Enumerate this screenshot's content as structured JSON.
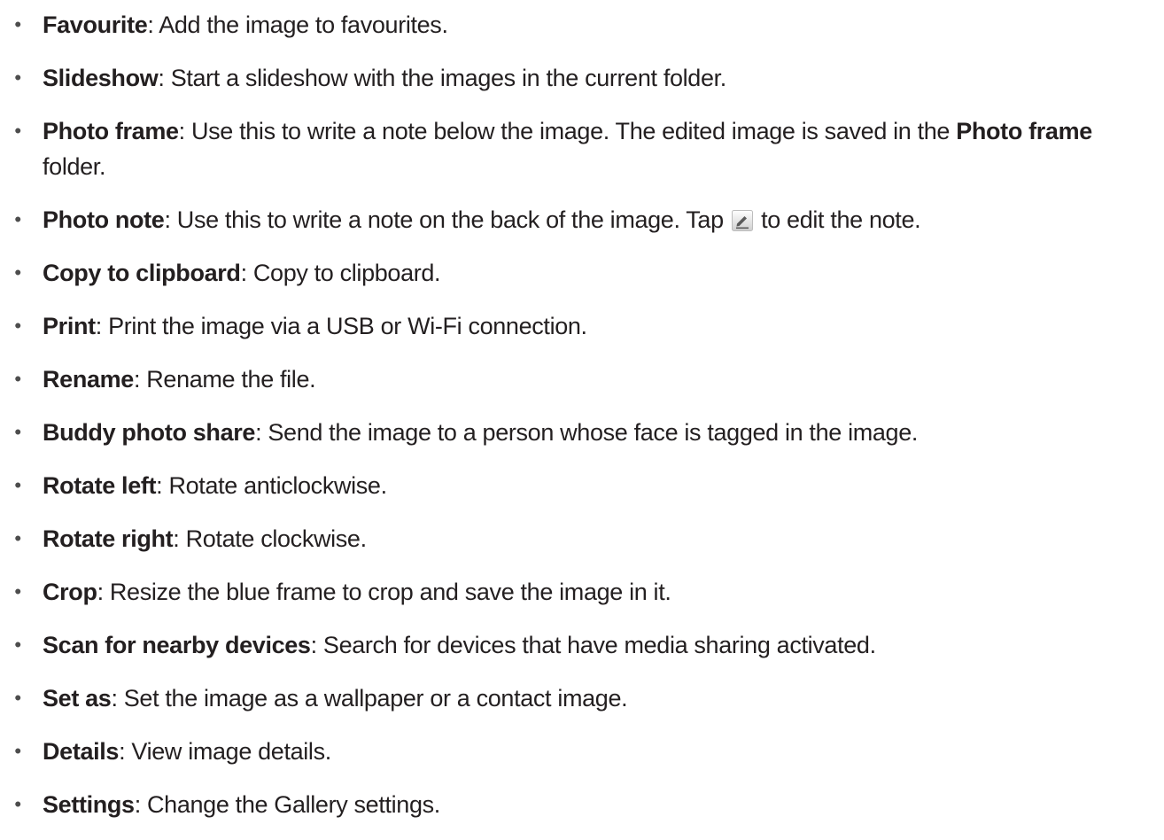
{
  "options": [
    {
      "term": "Favourite",
      "sep": ": ",
      "desc": "Add the image to favourites."
    },
    {
      "term": "Slideshow",
      "sep": ": ",
      "desc": "Start a slideshow with the images in the current folder."
    },
    {
      "term": "Photo frame",
      "sep": ": ",
      "desc": "Use this to write a note below the image. The edited image is saved in the ",
      "term2": "Photo frame",
      "desc2": " folder."
    },
    {
      "term": "Photo note",
      "sep": ": ",
      "desc": "Use this to write a note on the back of the image. Tap ",
      "icon": "pencil-edit-icon",
      "desc2": " to edit the note."
    },
    {
      "term": "Copy to clipboard",
      "sep": ": ",
      "desc": "Copy to clipboard."
    },
    {
      "term": "Print",
      "sep": ": ",
      "desc": "Print the image via a USB or Wi-Fi connection."
    },
    {
      "term": "Rename",
      "sep": ": ",
      "desc": "Rename the file."
    },
    {
      "term": "Buddy photo share",
      "sep": ": ",
      "desc": "Send the image to a person whose face is tagged in the image."
    },
    {
      "term": "Rotate left",
      "sep": ": ",
      "desc": "Rotate anticlockwise."
    },
    {
      "term": "Rotate right",
      "sep": ": ",
      "desc": "Rotate clockwise."
    },
    {
      "term": "Crop",
      "sep": ": ",
      "desc": "Resize the blue frame to crop and save the image in it."
    },
    {
      "term": "Scan for nearby devices",
      "sep": ": ",
      "desc": "Search for devices that have media sharing activated."
    },
    {
      "term": "Set as",
      "sep": ": ",
      "desc": "Set the image as a wallpaper or a contact image."
    },
    {
      "term": "Details",
      "sep": ": ",
      "desc": "View image details."
    },
    {
      "term": "Settings",
      "sep": ": ",
      "desc": "Change the Gallery settings."
    }
  ],
  "bullet": "•",
  "colors": {
    "text": "#231f20",
    "bullet": "#4d4d4d",
    "icon": "#5a5a5a"
  }
}
